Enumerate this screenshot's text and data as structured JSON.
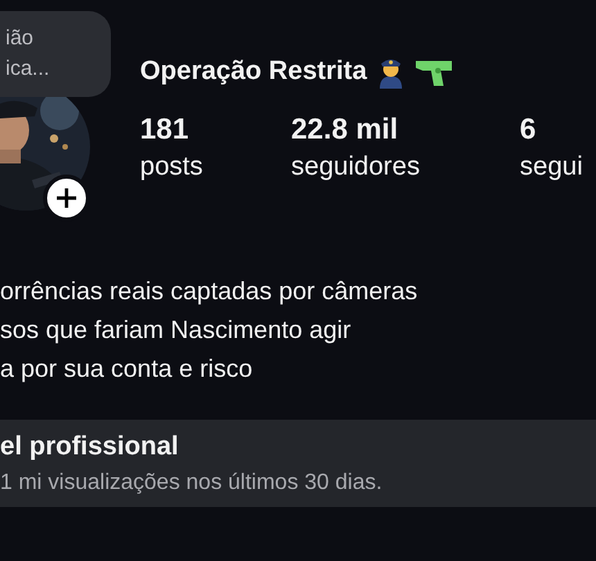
{
  "note": {
    "lines": [
      "ião",
      "ica..."
    ]
  },
  "profile": {
    "name": "Operação Restrita"
  },
  "stats": [
    {
      "value": "181",
      "label": "posts"
    },
    {
      "value": "22.8 mil",
      "label": "seguidores"
    },
    {
      "value": "6",
      "label": "segui"
    }
  ],
  "bio": [
    "orrências reais captadas por câmeras",
    "sos que fariam Nascimento agir",
    "a por sua conta e risco"
  ],
  "dashboard": {
    "title": "el profissional",
    "subtitle": "1 mi visualizações nos últimos 30 dias."
  }
}
